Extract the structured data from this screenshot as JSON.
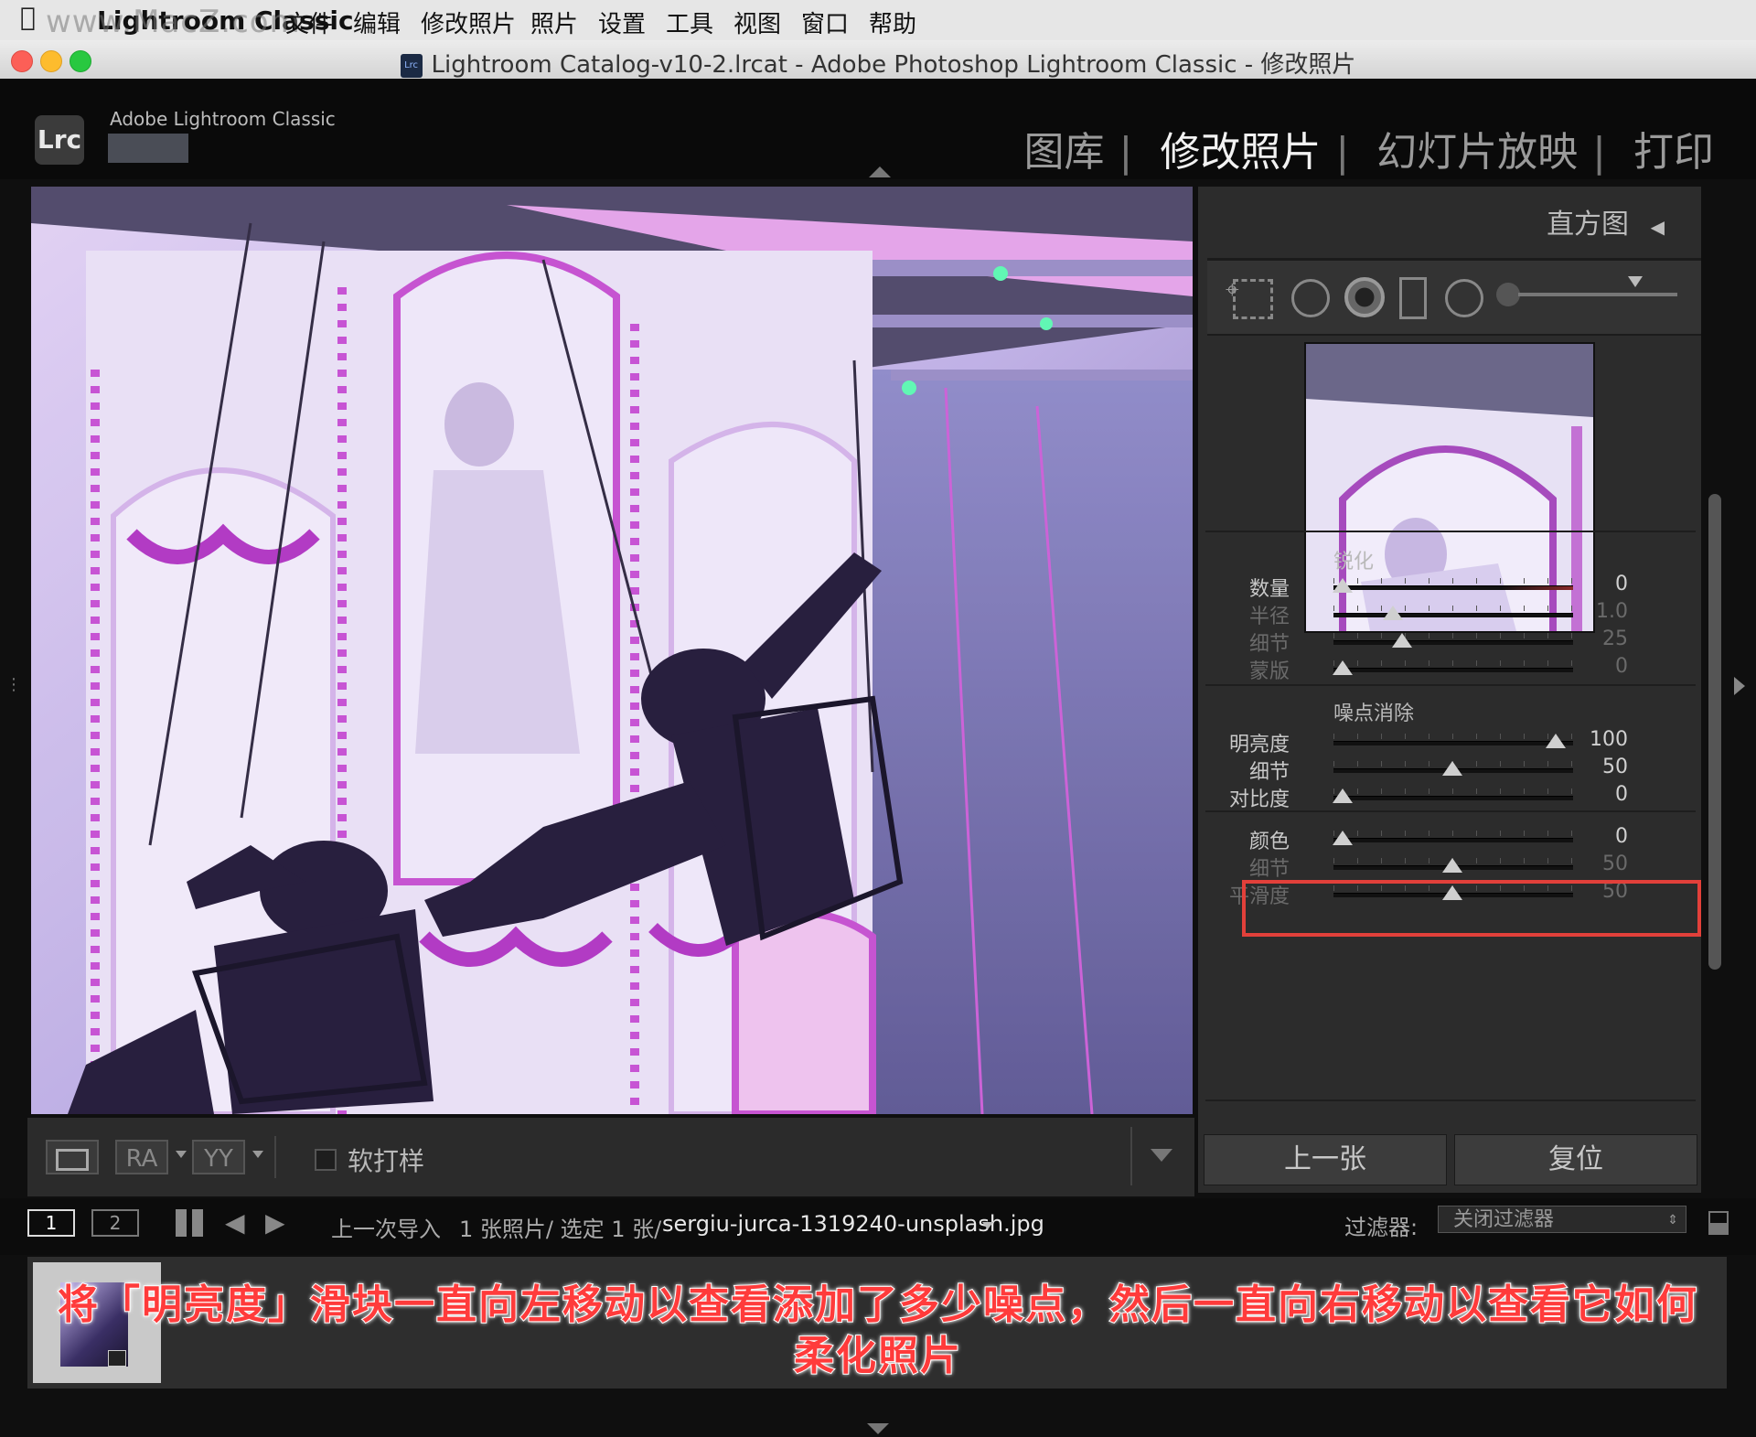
{
  "menubar": {
    "apple_icon": "apple-icon",
    "watermark": "www.MacZ.com",
    "app_name": "Lightroom Classic",
    "items": [
      "文件",
      "编辑",
      "修改照片",
      "照片",
      "设置",
      "工具",
      "视图",
      "窗口",
      "帮助"
    ]
  },
  "window": {
    "title": "Lightroom Catalog-v10-2.lrcat - Adobe Photoshop Lightroom Classic - 修改照片",
    "icon_text": "Lrc"
  },
  "header": {
    "logo": "Lrc",
    "brand": "Adobe Lightroom Classic",
    "modules": [
      "图库",
      "修改照片",
      "幻灯片放映",
      "打印"
    ],
    "active_module": "修改照片"
  },
  "toolbar": {
    "view_button_1": "RA",
    "view_button_2": "YY",
    "soft_proof": "软打样"
  },
  "right_panel": {
    "histogram_label": "直方图",
    "sharpening": {
      "title": "锐化",
      "sliders": [
        {
          "label": "数量",
          "value": "0",
          "pos": 0.0,
          "dim": false,
          "red": true
        },
        {
          "label": "半径",
          "value": "1.0",
          "pos": 0.23,
          "dim": true,
          "red": false
        },
        {
          "label": "细节",
          "value": "25",
          "pos": 0.27,
          "dim": true,
          "red": false
        },
        {
          "label": "蒙版",
          "value": "0",
          "pos": 0.0,
          "dim": true,
          "red": false
        }
      ]
    },
    "noise_reduction": {
      "title": "噪点消除",
      "sliders": [
        {
          "label": "明亮度",
          "value": "100",
          "pos": 0.97,
          "dim": false,
          "red": false
        },
        {
          "label": "细节",
          "value": "50",
          "pos": 0.5,
          "dim": false,
          "red": false
        },
        {
          "label": "对比度",
          "value": "0",
          "pos": 0.0,
          "dim": false,
          "red": false
        },
        {
          "label": "颜色",
          "value": "0",
          "pos": 0.0,
          "dim": false,
          "red": false
        },
        {
          "label": "细节",
          "value": "50",
          "pos": 0.5,
          "dim": true,
          "red": false
        },
        {
          "label": "平滑度",
          "value": "50",
          "pos": 0.5,
          "dim": true,
          "red": false
        }
      ]
    },
    "prev_button": "上一张",
    "reset_button": "复位"
  },
  "filmstrip_bar": {
    "page1": "1",
    "page2": "2",
    "source": "上一次导入",
    "count": "1 张照片/ 选定 1 张/",
    "filename": "sergiu-jurca-1319240-unsplash.jpg",
    "filter_label": "过滤器:",
    "filter_value": "关闭过滤器"
  },
  "caption": {
    "line1": "将「明亮度」滑块一直向左移动以查看添加了多少噪点，然后一直向右移动以查看它如何",
    "line2": "柔化照片"
  },
  "colors": {
    "highlight": "#e2403a",
    "caption_text": "#ff3b3b",
    "panel_bg": "#2c2c2c"
  }
}
